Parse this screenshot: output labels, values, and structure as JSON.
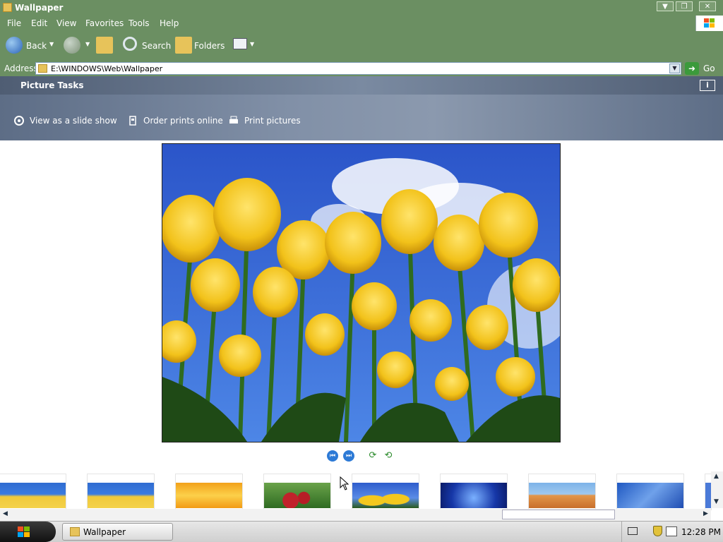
{
  "window": {
    "title": "Wallpaper"
  },
  "menu": [
    "File",
    "Edit",
    "View",
    "Favorites",
    "Tools",
    "Help"
  ],
  "toolbar": {
    "back": "Back",
    "search": "Search",
    "folders": "Folders"
  },
  "address": {
    "label": "Address",
    "path": "E:\\WINDOWS\\Web\\Wallpaper",
    "go": "Go"
  },
  "tasks": {
    "title": "Picture Tasks",
    "items": [
      "View as a slide show",
      "Order prints online",
      "Print pictures"
    ]
  },
  "icons": {
    "back": "back-arrow-icon",
    "forward": "forward-arrow-icon",
    "up": "up-folder-icon",
    "search": "search-icon",
    "folders": "folders-icon",
    "views": "views-icon",
    "info": "info-icon",
    "slideshow": "slideshow-icon",
    "order": "order-prints-icon",
    "print": "print-icon",
    "prev": "previous-image-icon",
    "next": "next-image-icon",
    "rotate_cw": "rotate-clockwise-icon",
    "rotate_ccw": "rotate-counterclockwise-icon"
  },
  "colors": {
    "chrome": "#6b8f62",
    "task_pane": "#7a8aa1",
    "accent": "#2d7ad6"
  },
  "taskbar": {
    "window_button": "Wallpaper",
    "clock": "12:28 PM"
  }
}
